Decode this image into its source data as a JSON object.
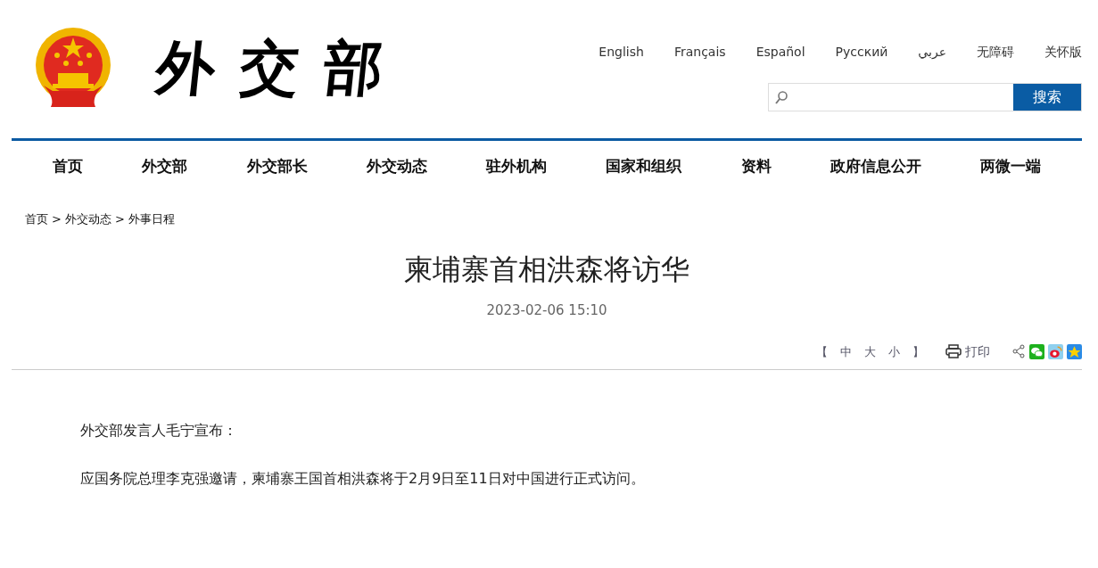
{
  "header": {
    "logo_text": "外交部",
    "languages": [
      "English",
      "Français",
      "Español",
      "Русский",
      "عربي",
      "无障碍",
      "关怀版"
    ],
    "search": {
      "button": "搜索"
    }
  },
  "nav": [
    {
      "label": "首页"
    },
    {
      "label": "外交部"
    },
    {
      "label": "外交部长"
    },
    {
      "label": "外交动态"
    },
    {
      "label": "驻外机构"
    },
    {
      "label": "国家和组织"
    },
    {
      "label": "资料"
    },
    {
      "label": "政府信息公开"
    },
    {
      "label": "两微一端"
    }
  ],
  "breadcrumb": [
    "首页",
    "外交动态",
    "外事日程"
  ],
  "breadcrumb_separator": ">",
  "article": {
    "title": "柬埔寨首相洪森将访华",
    "date": "2023-02-06 15:10",
    "font_size": {
      "open": "【",
      "options": [
        "中",
        "大",
        "小"
      ],
      "close": "】"
    },
    "print": "打印",
    "paragraphs": [
      "外交部发言人毛宁宣布：",
      "应国务院总理李克强邀请，柬埔寨王国首相洪森将于2月9日至11日对中国进行正式访问。"
    ]
  }
}
